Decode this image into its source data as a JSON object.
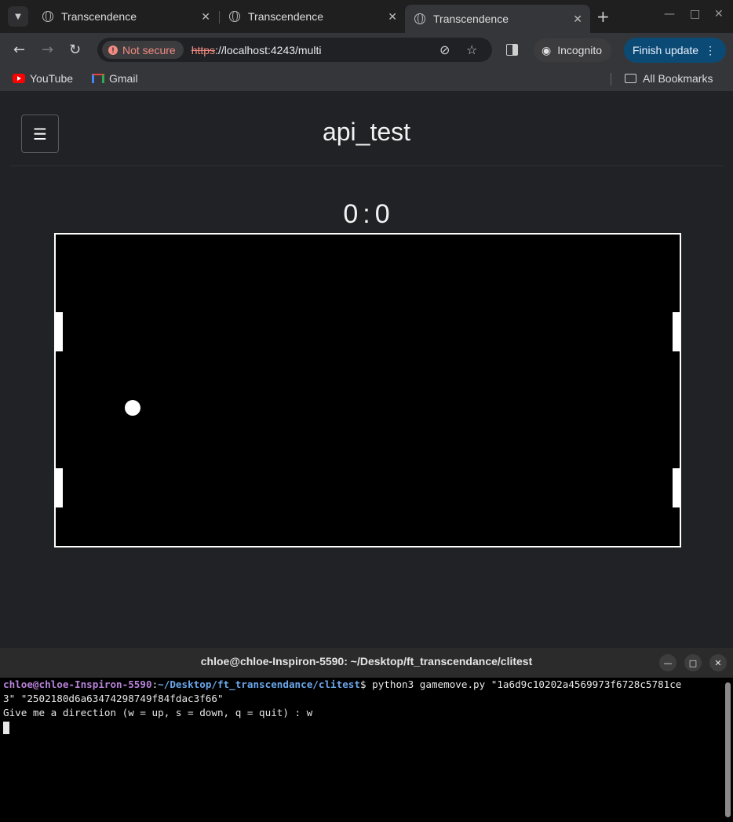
{
  "browser": {
    "tabs": [
      {
        "title": "Transcendence",
        "active": false
      },
      {
        "title": "Transcendence",
        "active": false
      },
      {
        "title": "Transcendence",
        "active": true
      }
    ],
    "security_label": "Not secure",
    "url_scheme": "https",
    "url_rest": "://localhost:4243/multi",
    "incognito_label": "Incognito",
    "update_label": "Finish update",
    "bookmarks": [
      {
        "label": "YouTube",
        "icon": "youtube-icon"
      },
      {
        "label": "Gmail",
        "icon": "gmail-icon"
      }
    ],
    "all_bookmarks_label": "All Bookmarks"
  },
  "page": {
    "title": "api_test",
    "score_left": "0",
    "score_sep": ":",
    "score_right": "0"
  },
  "game": {
    "court_color": "#000000",
    "line_color": "#ffffff"
  },
  "terminal": {
    "title": "chloe@chloe-Inspiron-5590: ~/Desktop/ft_transcendance/clitest",
    "prompt_user": "chloe@chloe-Inspiron-5590",
    "prompt_colon": ":",
    "prompt_path": "~/Desktop/ft_transcendance/clitest",
    "prompt_dollar": "$ ",
    "command_part1": "python3 gamemove.py \"1a6d9c10202a4569973f6728c5781ce",
    "command_part2": "3\" \"2502180d6a63474298749f84fdac3f66\"",
    "output_line": "Give me a direction (w = up, s = down, q = quit) : w"
  }
}
